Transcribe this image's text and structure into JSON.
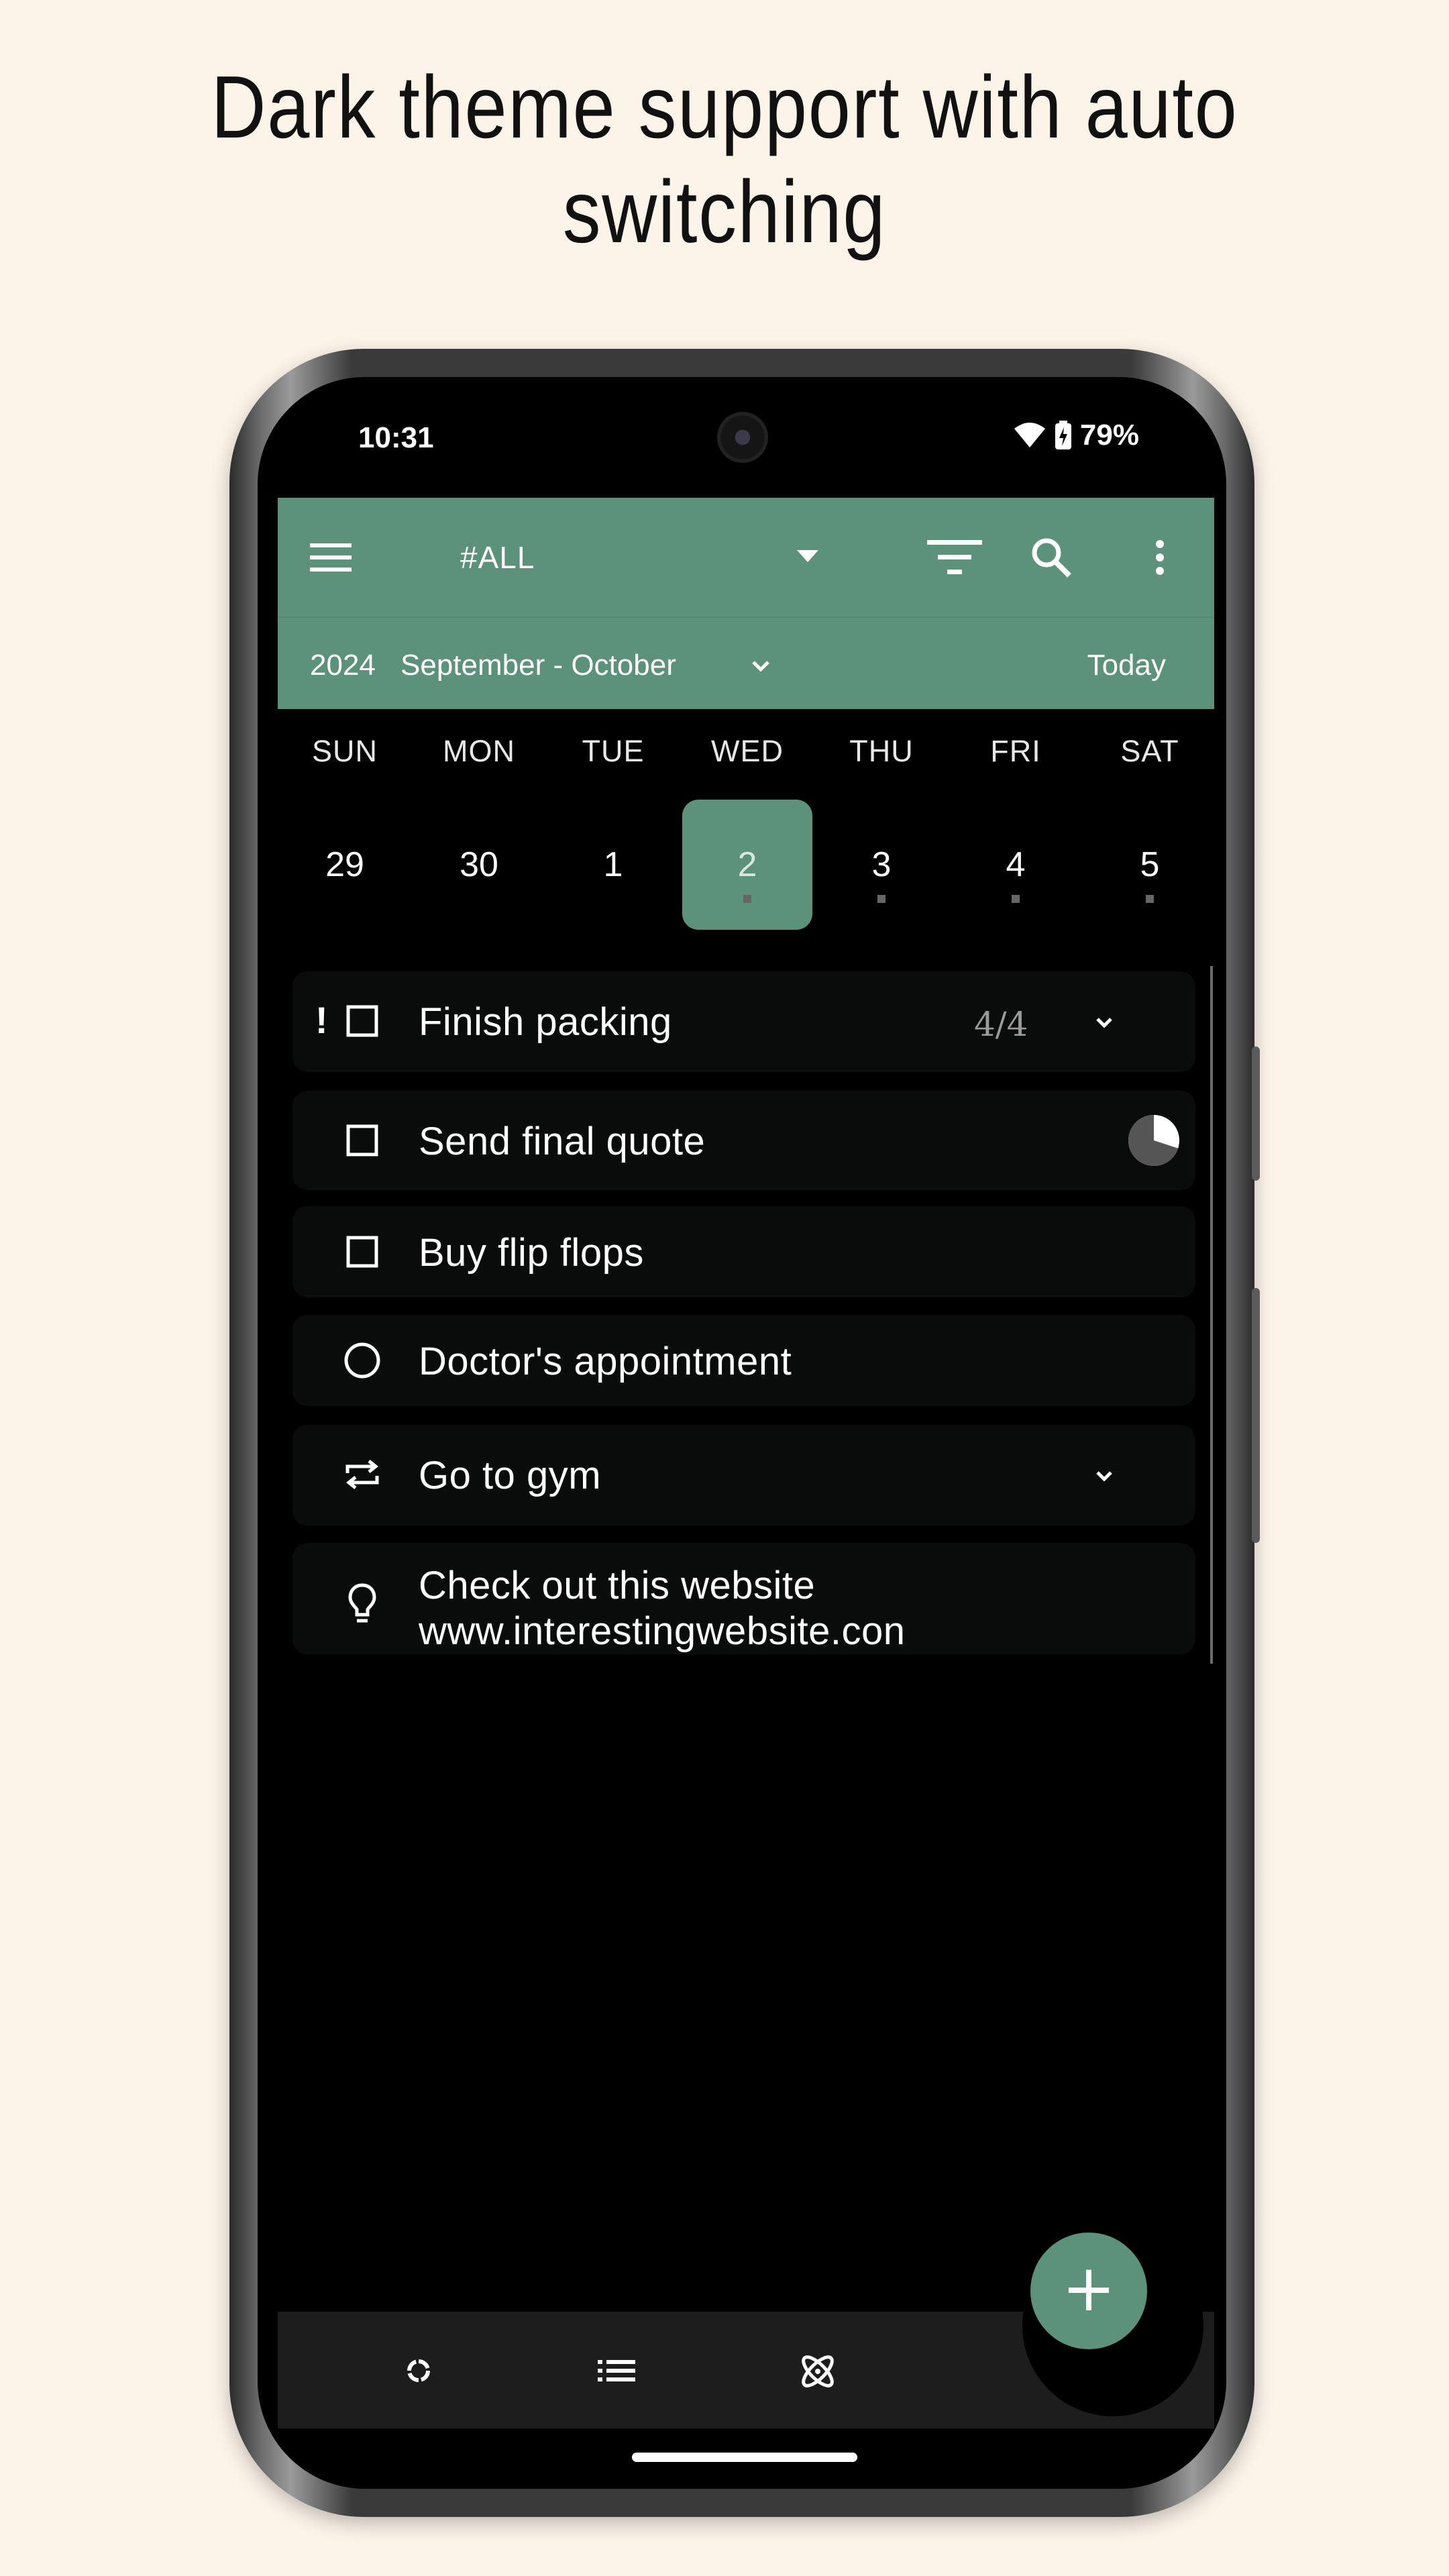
{
  "headline": {
    "line1": "Dark theme support with auto",
    "line2": "switching"
  },
  "status_bar": {
    "time": "10:31",
    "battery": "79%",
    "icons": [
      "wifi-icon",
      "battery-icon"
    ]
  },
  "app_bar": {
    "menu_icon": "hamburger-icon",
    "filter_label": "#ALL",
    "actions": [
      "sort-filter-icon",
      "search-icon",
      "more-vert-icon"
    ]
  },
  "date_bar": {
    "year": "2024",
    "range": "September - October",
    "today_label": "Today"
  },
  "week": {
    "days_of_week": [
      "SUN",
      "MON",
      "TUE",
      "WED",
      "THU",
      "FRI",
      "SAT"
    ],
    "dates": [
      "29",
      "30",
      "1",
      "2",
      "3",
      "4",
      "5"
    ],
    "selected_index": 3,
    "has_tasks": [
      false,
      false,
      false,
      true,
      true,
      true,
      true
    ]
  },
  "tasks": [
    {
      "title": "Finish packing",
      "icon": "checkbox-icon",
      "priority": "!",
      "count": "4/4",
      "expandable": true
    },
    {
      "title": "Send final quote",
      "icon": "checkbox-icon",
      "progress": 0.3
    },
    {
      "title": "Buy flip flops",
      "icon": "checkbox-icon"
    },
    {
      "title": "Doctor's appointment",
      "icon": "event-circle-icon"
    },
    {
      "title": "Go to gym",
      "icon": "repeat-icon",
      "expandable": true
    },
    {
      "title": "Check out this website",
      "subtitle": "www.interestingwebsite.con",
      "icon": "lightbulb-icon"
    }
  ],
  "bottom_nav": {
    "items": [
      "habit-ring-icon",
      "list-icon",
      "atom-icon"
    ]
  },
  "fab": {
    "label": "+"
  },
  "colors": {
    "background": "#fdf4e9",
    "accent": "#5c917a",
    "screen": "#000000",
    "card": "#0a0b0b",
    "nav": "#1d1d1d"
  }
}
